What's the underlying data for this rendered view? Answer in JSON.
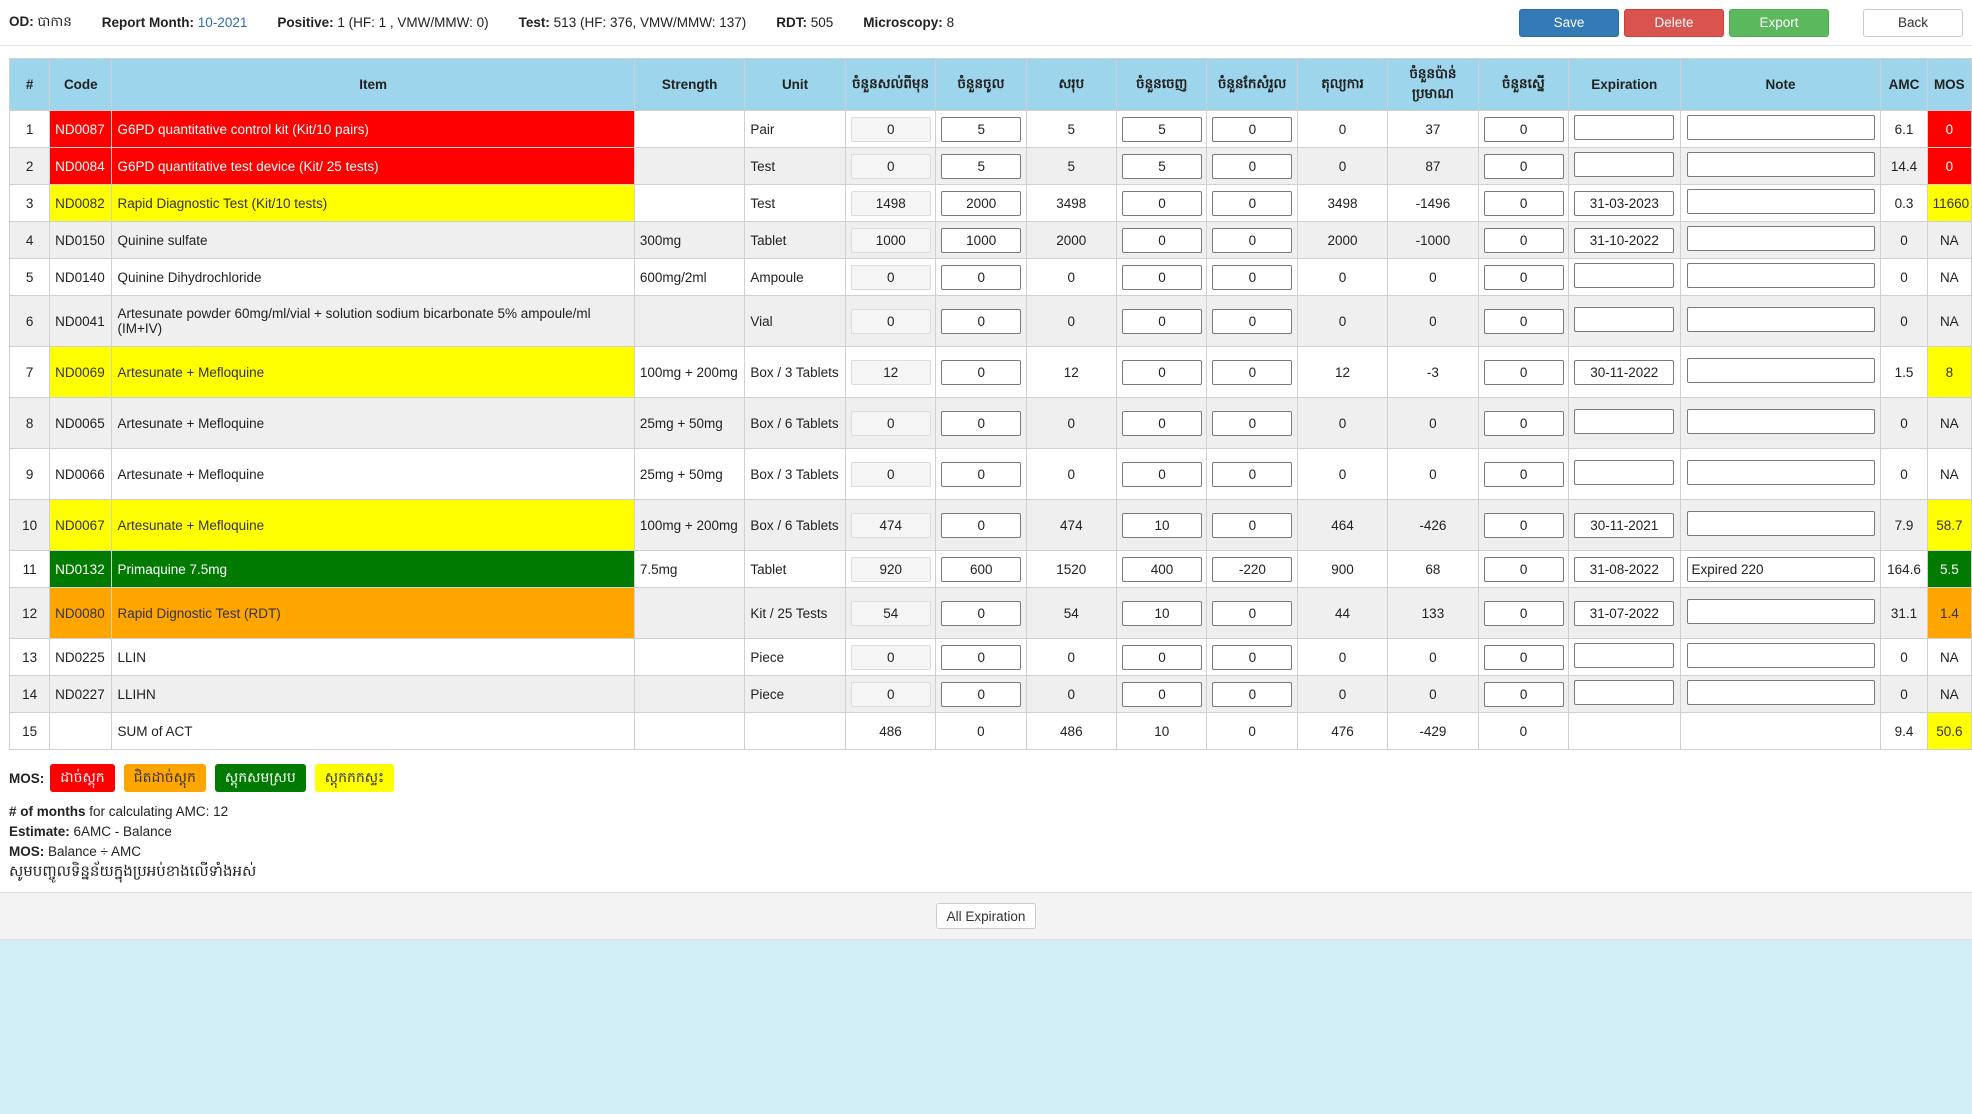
{
  "header": {
    "od_label": "OD:",
    "od_value": "បាកាន",
    "report_month_label": "Report Month:",
    "report_month_value": "10-2021",
    "positive_label": "Positive:",
    "positive_value": "1 (HF: 1 , VMW/MMW: 0)",
    "test_label": "Test:",
    "test_value": "513 (HF: 376, VMW/MMW: 137)",
    "rdt_label": "RDT:",
    "rdt_value": "505",
    "microscopy_label": "Microscopy:",
    "microscopy_value": "8"
  },
  "actions": {
    "save": "Save",
    "delete": "Delete",
    "export": "Export",
    "back": "Back"
  },
  "columns": [
    "#",
    "Code",
    "Item",
    "Strength",
    "Unit",
    "ចំនួនសល់ពីមុន",
    "ចំនួនចូល",
    "សរុប",
    "ចំនួនចេញ",
    "ចំនួនកែសំរួល",
    "តុល្យការ",
    "ចំនួនប៉ាន់ប្រមាណ",
    "ចំនួនស្នើ",
    "Expiration",
    "Note",
    "AMC",
    "MOS"
  ],
  "rows": [
    {
      "num": "1",
      "code": "ND0087",
      "item": "G6PD quantitative control kit (Kit/10 pairs)",
      "strength": "",
      "unit": "Pair",
      "prev": "0",
      "in": "5",
      "total": "5",
      "out": "5",
      "adjust": "0",
      "balance": "0",
      "estimate": "37",
      "request": "0",
      "expiration": "",
      "note": "",
      "amc": "6.1",
      "mos": "0",
      "item_color": "red",
      "mos_color": "red"
    },
    {
      "num": "2",
      "code": "ND0084",
      "item": "G6PD quantitative test device (Kit/ 25 tests)",
      "strength": "",
      "unit": "Test",
      "prev": "0",
      "in": "5",
      "total": "5",
      "out": "5",
      "adjust": "0",
      "balance": "0",
      "estimate": "87",
      "request": "0",
      "expiration": "",
      "note": "",
      "amc": "14.4",
      "mos": "0",
      "item_color": "red",
      "mos_color": "red"
    },
    {
      "num": "3",
      "code": "ND0082",
      "item": "Rapid Diagnostic Test (Kit/10 tests)",
      "strength": "",
      "unit": "Test",
      "prev": "1498",
      "in": "2000",
      "total": "3498",
      "out": "0",
      "adjust": "0",
      "balance": "3498",
      "estimate": "-1496",
      "request": "0",
      "expiration": "31-03-2023",
      "note": "",
      "amc": "0.3",
      "mos": "11660",
      "item_color": "yellow",
      "mos_color": "yellow"
    },
    {
      "num": "4",
      "code": "ND0150",
      "item": "Quinine sulfate",
      "strength": "300mg",
      "unit": "Tablet",
      "prev": "1000",
      "in": "1000",
      "total": "2000",
      "out": "0",
      "adjust": "0",
      "balance": "2000",
      "estimate": "-1000",
      "request": "0",
      "expiration": "31-10-2022",
      "note": "",
      "amc": "0",
      "mos": "NA",
      "item_color": "",
      "mos_color": ""
    },
    {
      "num": "5",
      "code": "ND0140",
      "item": "Quinine Dihydrochloride",
      "strength": "600mg/2ml",
      "unit": "Ampoule",
      "prev": "0",
      "in": "0",
      "total": "0",
      "out": "0",
      "adjust": "0",
      "balance": "0",
      "estimate": "0",
      "request": "0",
      "expiration": "",
      "note": "",
      "amc": "0",
      "mos": "NA",
      "item_color": "",
      "mos_color": ""
    },
    {
      "num": "6",
      "code": "ND0041",
      "item": "Artesunate powder 60mg/ml/vial + solution sodium bicarbonate 5% ampoule/ml (IM+IV)",
      "strength": "",
      "unit": "Vial",
      "prev": "0",
      "in": "0",
      "total": "0",
      "out": "0",
      "adjust": "0",
      "balance": "0",
      "estimate": "0",
      "request": "0",
      "expiration": "",
      "note": "",
      "amc": "0",
      "mos": "NA",
      "item_color": "",
      "mos_color": ""
    },
    {
      "num": "7",
      "code": "ND0069",
      "item": "Artesunate + Mefloquine",
      "strength": "100mg + 200mg",
      "unit": "Box / 3 Tablets",
      "prev": "12",
      "in": "0",
      "total": "12",
      "out": "0",
      "adjust": "0",
      "balance": "12",
      "estimate": "-3",
      "request": "0",
      "expiration": "30-11-2022",
      "note": "",
      "amc": "1.5",
      "mos": "8",
      "item_color": "yellow",
      "mos_color": "yellow"
    },
    {
      "num": "8",
      "code": "ND0065",
      "item": "Artesunate + Mefloquine",
      "strength": "25mg + 50mg",
      "unit": "Box / 6 Tablets",
      "prev": "0",
      "in": "0",
      "total": "0",
      "out": "0",
      "adjust": "0",
      "balance": "0",
      "estimate": "0",
      "request": "0",
      "expiration": "",
      "note": "",
      "amc": "0",
      "mos": "NA",
      "item_color": "",
      "mos_color": ""
    },
    {
      "num": "9",
      "code": "ND0066",
      "item": "Artesunate + Mefloquine",
      "strength": "25mg + 50mg",
      "unit": "Box / 3 Tablets",
      "prev": "0",
      "in": "0",
      "total": "0",
      "out": "0",
      "adjust": "0",
      "balance": "0",
      "estimate": "0",
      "request": "0",
      "expiration": "",
      "note": "",
      "amc": "0",
      "mos": "NA",
      "item_color": "",
      "mos_color": ""
    },
    {
      "num": "10",
      "code": "ND0067",
      "item": "Artesunate + Mefloquine",
      "strength": "100mg + 200mg",
      "unit": "Box / 6 Tablets",
      "prev": "474",
      "in": "0",
      "total": "474",
      "out": "10",
      "adjust": "0",
      "balance": "464",
      "estimate": "-426",
      "request": "0",
      "expiration": "30-11-2021",
      "note": "",
      "amc": "7.9",
      "mos": "58.7",
      "item_color": "yellow",
      "mos_color": "yellow"
    },
    {
      "num": "11",
      "code": "ND0132",
      "item": "Primaquine 7.5mg",
      "strength": "7.5mg",
      "unit": "Tablet",
      "prev": "920",
      "in": "600",
      "total": "1520",
      "out": "400",
      "adjust": "-220",
      "balance": "900",
      "estimate": "68",
      "request": "0",
      "expiration": "31-08-2022",
      "note": "Expired 220",
      "amc": "164.6",
      "mos": "5.5",
      "item_color": "green",
      "mos_color": "green"
    },
    {
      "num": "12",
      "code": "ND0080",
      "item": "Rapid Dignostic Test (RDT)",
      "strength": "",
      "unit": "Kit / 25 Tests",
      "prev": "54",
      "in": "0",
      "total": "54",
      "out": "10",
      "adjust": "0",
      "balance": "44",
      "estimate": "133",
      "request": "0",
      "expiration": "31-07-2022",
      "note": "",
      "amc": "31.1",
      "mos": "1.4",
      "item_color": "orange",
      "mos_color": "orange"
    },
    {
      "num": "13",
      "code": "ND0225",
      "item": "LLIN",
      "strength": "",
      "unit": "Piece",
      "prev": "0",
      "in": "0",
      "total": "0",
      "out": "0",
      "adjust": "0",
      "balance": "0",
      "estimate": "0",
      "request": "0",
      "expiration": "",
      "note": "",
      "amc": "0",
      "mos": "NA",
      "item_color": "",
      "mos_color": ""
    },
    {
      "num": "14",
      "code": "ND0227",
      "item": "LLIHN",
      "strength": "",
      "unit": "Piece",
      "prev": "0",
      "in": "0",
      "total": "0",
      "out": "0",
      "adjust": "0",
      "balance": "0",
      "estimate": "0",
      "request": "0",
      "expiration": "",
      "note": "",
      "amc": "0",
      "mos": "NA",
      "item_color": "",
      "mos_color": ""
    }
  ],
  "sum_row": {
    "num": "15",
    "label": "SUM of ACT",
    "prev": "486",
    "in": "0",
    "total": "486",
    "out": "10",
    "adjust": "0",
    "balance": "476",
    "estimate": "-429",
    "request": "0",
    "amc": "9.4",
    "mos": "50.6",
    "mos_color": "yellow"
  },
  "legend": {
    "label": "MOS:",
    "items": [
      {
        "text": "ដាច់ស្តុក",
        "color": "red"
      },
      {
        "text": "ជិតដាច់ស្តុក",
        "color": "orange"
      },
      {
        "text": "ស្តុកសមស្រប",
        "color": "green"
      },
      {
        "text": "ស្តុកកកស្ទះ",
        "color": "yellow"
      }
    ]
  },
  "notes": {
    "months_label": "# of months",
    "months_text": "for calculating AMC: 12",
    "estimate_label": "Estimate:",
    "estimate_text": "6AMC - Balance",
    "mos_label": "MOS:",
    "mos_text": "Balance ÷ AMC",
    "khmer": "សូមបញ្ចូលទិន្នន័យក្នុងប្រអប់ខាងលើទាំងអស់"
  },
  "footer": {
    "all_expiration": "All Expiration"
  },
  "colors": {
    "header_bg": "#9dd6ec",
    "red": "#ff0000",
    "yellow": "#ffff00",
    "green": "#007a00",
    "orange": "#ffa500",
    "page_bg": "#d1eef6"
  }
}
